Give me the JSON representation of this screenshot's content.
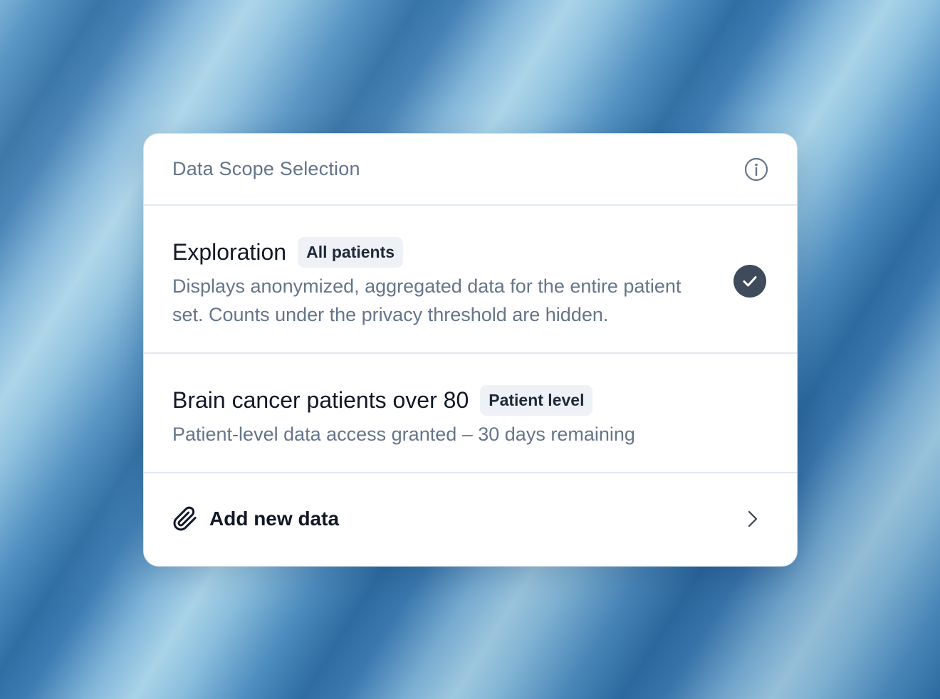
{
  "header": {
    "title": "Data Scope Selection",
    "info_icon": "info-icon"
  },
  "options": [
    {
      "title": "Exploration",
      "badge": "All patients",
      "description": "Displays anonymized, aggregated data for the entire patient set. Counts under the privacy threshold are hidden.",
      "selected": true
    },
    {
      "title": "Brain cancer patients over 80",
      "badge": "Patient level",
      "description": "Patient-level data access granted – 30 days remaining",
      "selected": false
    }
  ],
  "add_data": {
    "label": "Add new data",
    "icon": "paperclip-icon",
    "chevron": "chevron-right-icon"
  },
  "colors": {
    "check_fill": "#3f4b5b",
    "muted_text": "#65758a",
    "badge_bg": "#eef1f5"
  }
}
